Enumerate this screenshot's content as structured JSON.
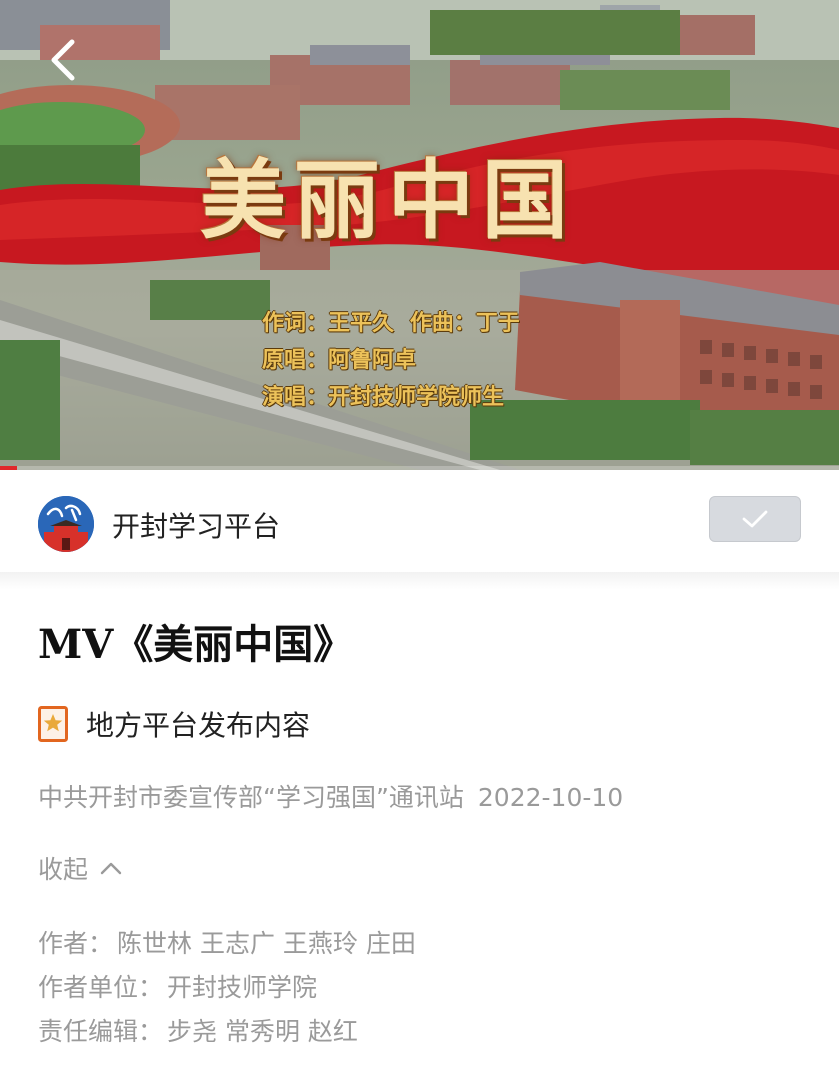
{
  "video": {
    "title_overlay": "美丽中国",
    "credits": [
      [
        "作词：王平久",
        "作曲：丁于"
      ],
      [
        "原唱：阿鲁阿卓"
      ],
      [
        "演唱：开封技师学院师生"
      ]
    ],
    "progress": 0.02,
    "progress_color": "#e0282b"
  },
  "channel": {
    "name": "开封学习平台",
    "subscribe_icon": "check-icon"
  },
  "article": {
    "title": "MV《美丽中国》",
    "source_tag": {
      "icon": "star-bookmark-icon",
      "label": "地方平台发布内容"
    },
    "publisher": "中共开封市委宣传部“学习强国”通讯站",
    "date": "2022-10-10",
    "collapse_label": "收起",
    "info": [
      {
        "label": "作者：",
        "value": "陈世林 王志广 王燕玲 庄田"
      },
      {
        "label": "作者单位：",
        "value": "开封技师学院"
      },
      {
        "label": "责任编辑：",
        "value": "步尧 常秀明 赵红"
      }
    ]
  },
  "colors": {
    "accent_red": "#e0282b",
    "tag_orange": "#e2661f",
    "meta_gray": "#9a9a9a"
  }
}
